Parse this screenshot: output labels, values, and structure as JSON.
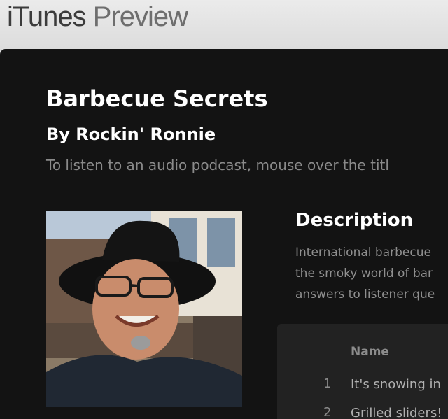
{
  "header": {
    "brand_itunes": "iTunes",
    "brand_preview": "Preview"
  },
  "podcast": {
    "title": "Barbecue Secrets",
    "author": "By Rockin' Ronnie",
    "hint": "To listen to an audio podcast, mouse over the titl",
    "artwork_alt": "artwork"
  },
  "description": {
    "heading": "Description",
    "lines": [
      "International barbecue",
      "the smoky world of bar",
      "answers to listener que"
    ]
  },
  "episodes": {
    "column_name": "Name",
    "rows": [
      {
        "num": "1",
        "name": "It's snowing in"
      },
      {
        "num": "2",
        "name": "Grilled sliders!"
      }
    ]
  },
  "colors": {
    "panel_bg": "#131313",
    "header_bg": "#e2e2e2",
    "table_bg": "#222222"
  }
}
